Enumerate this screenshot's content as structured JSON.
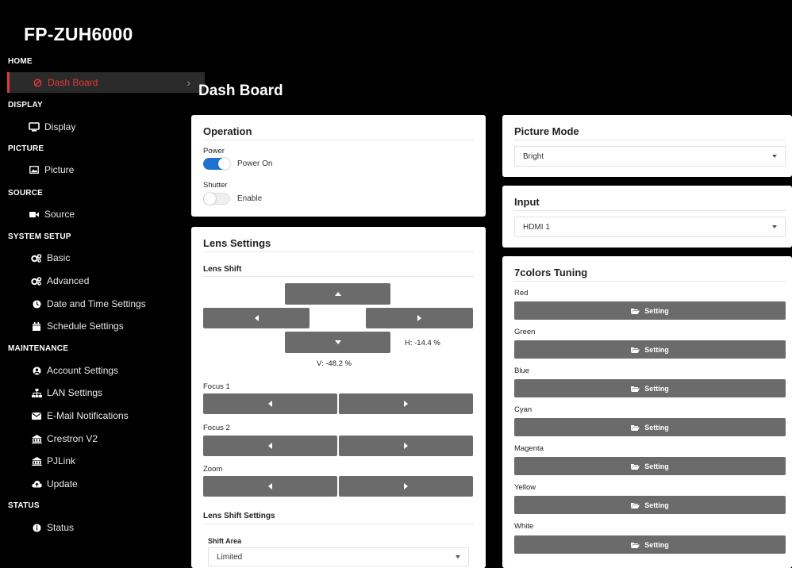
{
  "app": {
    "title": "FP-ZUH6000"
  },
  "sidebar": {
    "home": {
      "header": "HOME",
      "dashboard": "Dash Board"
    },
    "display": {
      "header": "DISPLAY",
      "item": "Display"
    },
    "picture": {
      "header": "PICTURE",
      "item": "Picture"
    },
    "source": {
      "header": "SOURCE",
      "item": "Source"
    },
    "system_setup": {
      "header": "SYSTEM SETUP",
      "basic": "Basic",
      "advanced": "Advanced",
      "date_time": "Date and Time Settings",
      "schedule": "Schedule Settings"
    },
    "maintenance": {
      "header": "MAINTENANCE",
      "account": "Account Settings",
      "lan": "LAN Settings",
      "email": "E-Mail Notifications",
      "crestron": "Crestron V2",
      "pjlink": "PJLink",
      "update": "Update"
    },
    "status": {
      "header": "STATUS",
      "item": "Status"
    }
  },
  "main": {
    "title": "Dash Board"
  },
  "operation": {
    "title": "Operation",
    "power_label": "Power",
    "power_state": "Power On",
    "shutter_label": "Shutter",
    "shutter_state": "Enable"
  },
  "lens": {
    "title": "Lens Settings",
    "shift_title": "Lens Shift",
    "h_readout": "H:  -14.4 %",
    "v_readout": "V:  -48.2 %",
    "focus1": "Focus 1",
    "focus2": "Focus 2",
    "zoom": "Zoom",
    "shift_settings_title": "Lens Shift Settings",
    "shift_area_label": "Shift Area",
    "shift_area_value": "Limited"
  },
  "picture_mode": {
    "title": "Picture Mode",
    "value": "Bright"
  },
  "input": {
    "title": "Input",
    "value": "HDMI 1"
  },
  "tuning": {
    "title": "7colors Tuning",
    "button_label": "Setting",
    "colors": [
      "Red",
      "Green",
      "Blue",
      "Cyan",
      "Magenta",
      "Yellow",
      "White"
    ]
  },
  "colors": {
    "accent": "#e53935",
    "toggle_on": "#1e73d2",
    "button_gray": "#6b6b6b"
  }
}
